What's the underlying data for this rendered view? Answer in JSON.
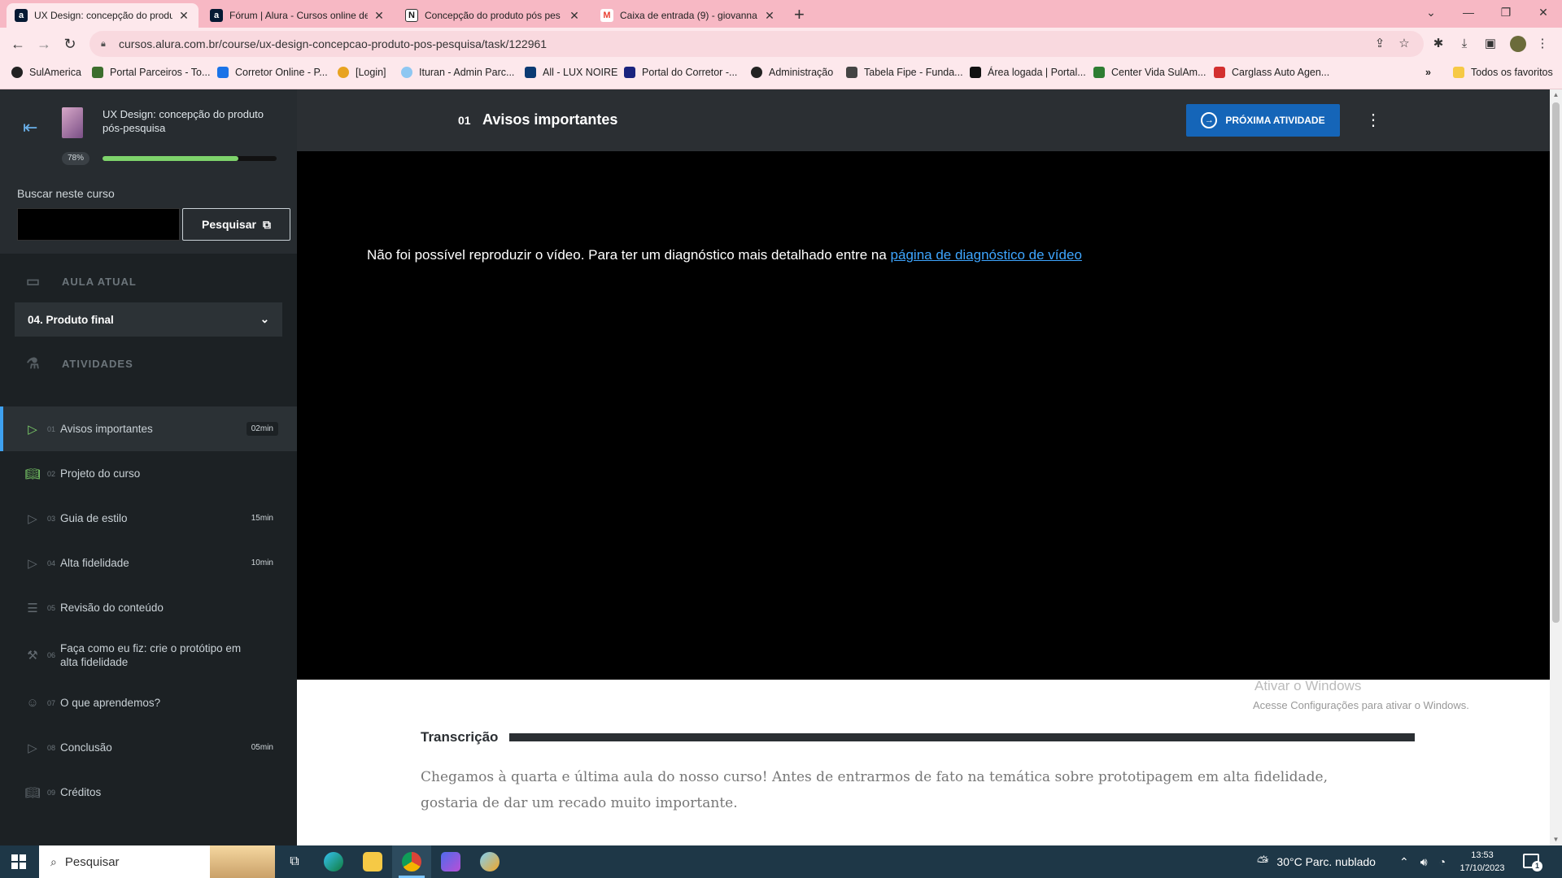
{
  "browser": {
    "tabs": [
      {
        "title": "UX Design: concepção do produ",
        "favicon": "a",
        "favicon_color": "#051933"
      },
      {
        "title": "Fórum | Alura - Cursos online de",
        "favicon": "a",
        "favicon_color": "#051933"
      },
      {
        "title": "Concepção do produto pós pes",
        "favicon": "N",
        "favicon_color": "#333333"
      },
      {
        "title": "Caixa de entrada (9) - giovanna",
        "favicon": "M",
        "favicon_color": "#ea4335"
      }
    ],
    "url": "cursos.alura.com.br/course/ux-design-concepcao-produto-pos-pesquisa/task/122961",
    "bookmarks": [
      "SulAmerica",
      "Portal Parceiros - To...",
      "Corretor Online - P...",
      "[Login]",
      "Ituran - Admin Parc...",
      "All - LUX NOIRE",
      "Portal do Corretor -...",
      "Administração",
      "Tabela Fipe - Funda...",
      "Área logada | Portal...",
      "Center Vida SulAm...",
      "Carglass Auto Agen..."
    ],
    "bookmarks_overflow": "»",
    "all_favorites": "Todos os favoritos",
    "tab_strip_color": "#f7b8c4"
  },
  "sidebar": {
    "course_title": "UX Design: concepção do produto pós-pesquisa",
    "progress_label": "78%",
    "progress_value": 0.78,
    "search_label": "Buscar neste curso",
    "search_value": "",
    "search_button": "Pesquisar",
    "current_section_label": "AULA ATUAL",
    "current_lesson": "04. Produto final",
    "activities_label": "ATIVIDADES",
    "activities": [
      {
        "num": "01",
        "label": "Avisos importantes",
        "duration": "02min",
        "icon": "video-icon"
      },
      {
        "num": "02",
        "label": "Projeto do curso",
        "duration": "",
        "icon": "book-icon"
      },
      {
        "num": "03",
        "label": "Guia de estilo",
        "duration": "15min",
        "icon": "video-icon"
      },
      {
        "num": "04",
        "label": "Alta fidelidade",
        "duration": "10min",
        "icon": "video-icon"
      },
      {
        "num": "05",
        "label": "Revisão do conteúdo",
        "duration": "",
        "icon": "list-icon"
      },
      {
        "num": "06",
        "label": "Faça como eu fiz: crie o protótipo em alta fidelidade",
        "duration": "",
        "icon": "tools-icon"
      },
      {
        "num": "07",
        "label": "O que aprendemos?",
        "duration": "",
        "icon": "person-icon"
      },
      {
        "num": "08",
        "label": "Conclusão",
        "duration": "05min",
        "icon": "video-icon"
      },
      {
        "num": "09",
        "label": "Créditos",
        "duration": "",
        "icon": "book-icon"
      }
    ],
    "accent": "#3ea1f0",
    "progress_color": "#7ed36b"
  },
  "main": {
    "activity_num": "01",
    "activity_title": "Avisos importantes",
    "next_button": "PRÓXIMA ATIVIDADE",
    "video_error": "Não foi possível reproduzir o vídeo. Para ter um diagnóstico mais detalhado entre na",
    "video_error_link": "página de diagnóstico de vídeo",
    "transcript_title": "Transcrição",
    "transcript_text": "Chegamos à quarta e última aula do nosso curso! Antes de entrarmos de fato na temática sobre prototipagem em alta fidelidade, gostaria de dar um recado muito importante.",
    "next_button_color": "#1565b8"
  },
  "windows": {
    "watermark_title": "Ativar o Windows",
    "watermark_text": "Acesse Configurações para ativar o Windows.",
    "search_placeholder": "Pesquisar",
    "weather": "30°C  Parc. nublado",
    "time": "13:53",
    "date": "17/10/2023",
    "notifications": "1"
  }
}
